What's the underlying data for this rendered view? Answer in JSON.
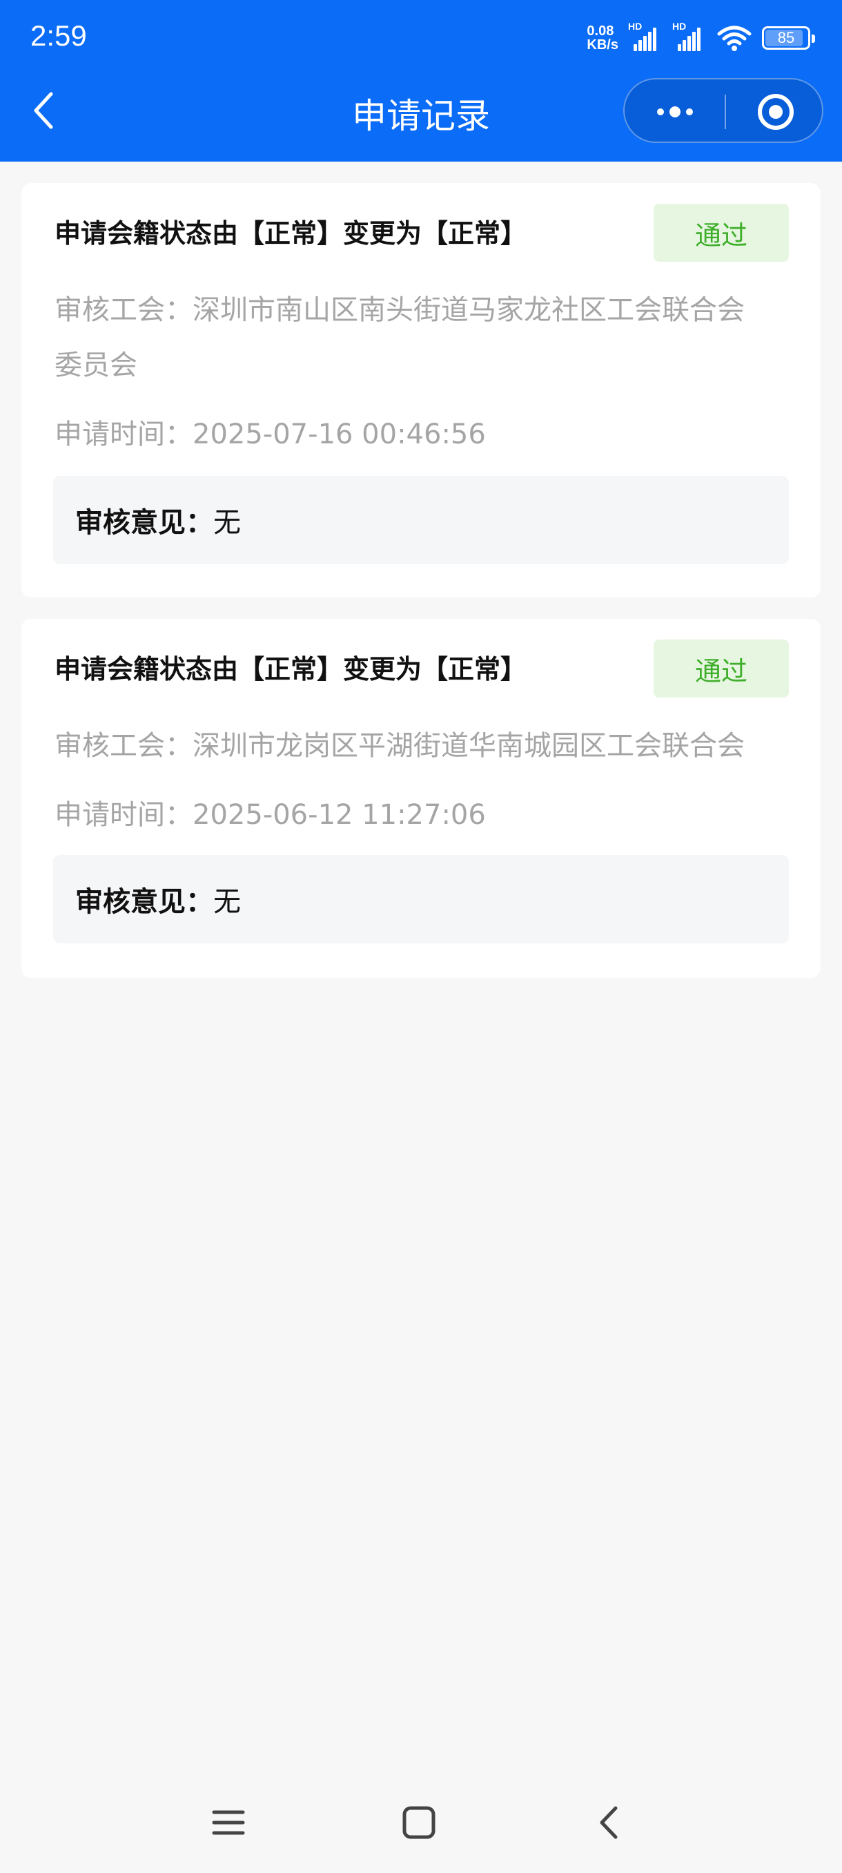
{
  "status_bar": {
    "time": "2:59",
    "net_speed_value": "0.08",
    "net_speed_unit": "KB/s",
    "hd_label_1": "HD",
    "hd_label_2": "HD",
    "battery": "85"
  },
  "header": {
    "title": "申请记录"
  },
  "records": [
    {
      "title": "申请会籍状态由【正常】变更为【正常】",
      "status": "通过",
      "union_label": "审核工会：",
      "union_value_line1": "深圳市南山区南头街道马家龙社区工会联合会",
      "union_value_line2": "委员会",
      "time_label": "申请时间：",
      "time_value": "2025-07-16 00:46:56",
      "opinion_label": "审核意见：",
      "opinion_value": "无"
    },
    {
      "title": "申请会籍状态由【正常】变更为【正常】",
      "status": "通过",
      "union_label": "审核工会：",
      "union_value_line1": "深圳市龙岗区平湖街道华南城园区工会联合会",
      "time_label": "申请时间：",
      "time_value": "2025-06-12 11:27:06",
      "opinion_label": "审核意见：",
      "opinion_value": "无"
    }
  ],
  "colors": {
    "header_bg": "#0a6cf7",
    "page_bg": "#f7f7f7",
    "badge_bg": "#e6f6e1",
    "badge_text": "#3fae2a",
    "secondary_text": "#a5a5a5"
  }
}
